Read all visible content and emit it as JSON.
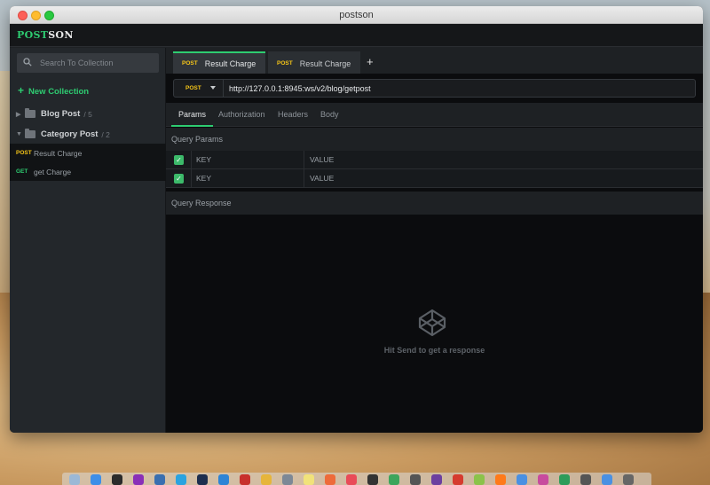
{
  "window": {
    "title": "postson"
  },
  "app": {
    "logo_part1": "POST",
    "logo_part2": "SON"
  },
  "sidebar": {
    "search_placeholder": "Search To Collection",
    "new_collection": "New Collection",
    "folders": [
      {
        "name": "Blog Post",
        "count": "/ 5",
        "expanded": false
      },
      {
        "name": "Category Post",
        "count": "/ 2",
        "expanded": true
      }
    ],
    "requests": [
      {
        "method": "POST",
        "name": "Result Charge"
      },
      {
        "method": "GET",
        "name": "get Charge"
      }
    ]
  },
  "tabs": [
    {
      "method": "POST",
      "label": "Result Charge",
      "active": true
    },
    {
      "method": "POST",
      "label": "Result Charge",
      "active": false
    }
  ],
  "tab_add": "+",
  "request": {
    "method": "POST",
    "url": "http://127.0.0.1:8945:ws/v2/blog/getpost"
  },
  "subtabs": [
    "Params",
    "Authorization",
    "Headers",
    "Body"
  ],
  "query_params": {
    "title": "Query Params",
    "rows": [
      {
        "checked": true,
        "key": "KEY",
        "value": "VALUE"
      },
      {
        "checked": true,
        "key": "KEY",
        "value": "VALUE"
      }
    ]
  },
  "query_response": {
    "title": "Query Response",
    "empty_text": "Hit Send to get a response"
  },
  "colors": {
    "accent": "#2ecc71",
    "post": "#f5c518",
    "get": "#2ecc71"
  },
  "dock": {
    "icon_names": [
      "finder-icon",
      "safari-icon",
      "terminal-icon",
      "phpstorm-icon",
      "app-icon",
      "telegram-icon",
      "photoshop-icon",
      "vscode-icon",
      "filezilla-icon",
      "chrome-icon",
      "launchpad-icon",
      "notes-icon",
      "app-icon",
      "music-icon",
      "app-icon",
      "app-icon",
      "app-icon",
      "app-icon",
      "app-icon",
      "app-icon",
      "firefox-icon",
      "app-icon",
      "app-icon",
      "app-icon",
      "app-icon",
      "downloads-icon",
      "trash-icon"
    ]
  }
}
